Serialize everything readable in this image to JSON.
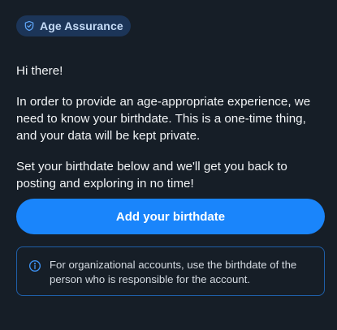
{
  "badge": {
    "icon": "shield-check-icon",
    "label": "Age Assurance"
  },
  "content": {
    "greeting": "Hi there!",
    "paragraph1": "In order to provide an age-appropriate experience, we need to know your birthdate. This is a one-time thing, and your data will be kept private.",
    "paragraph2": "Set your birthdate below and we'll get you back to posting and exploring in no time!"
  },
  "primary_button": {
    "label": "Add your birthdate"
  },
  "info": {
    "icon": "info-circle-icon",
    "text": "For organizational accounts, use the birthdate of the person who is responsible for the account."
  },
  "colors": {
    "background": "#161e27",
    "accent": "#1a85fb",
    "badge_bg": "#1c3558",
    "badge_text": "#c6dcf7",
    "info_border": "#1f5fa8"
  }
}
